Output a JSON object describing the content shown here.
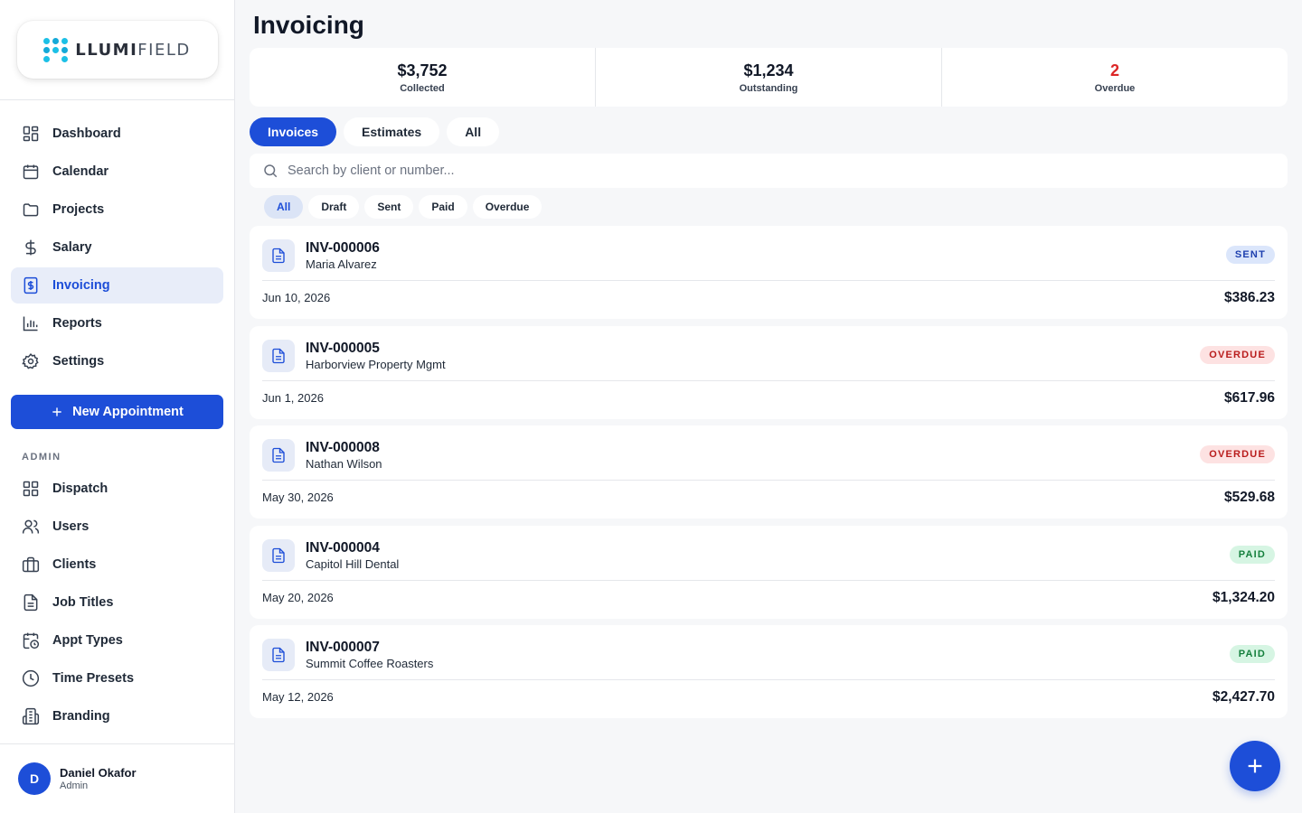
{
  "brand": {
    "logo_text_bold": "LLUMI",
    "logo_text_light": "FIELD",
    "logo_icon": "dots-pin-icon"
  },
  "sidebar": {
    "items": [
      {
        "label": "Dashboard",
        "icon": "grid-icon",
        "active": false
      },
      {
        "label": "Calendar",
        "icon": "calendar-icon",
        "active": false
      },
      {
        "label": "Projects",
        "icon": "folder-icon",
        "active": false
      },
      {
        "label": "Salary",
        "icon": "dollar-icon",
        "active": false
      },
      {
        "label": "Invoicing",
        "icon": "invoice-icon",
        "active": true
      },
      {
        "label": "Reports",
        "icon": "bar-chart-icon",
        "active": false
      },
      {
        "label": "Settings",
        "icon": "gear-icon",
        "active": false
      }
    ],
    "new_appointment_label": "New Appointment",
    "admin_label": "ADMIN",
    "admin_items": [
      {
        "label": "Dispatch",
        "icon": "grid-icon"
      },
      {
        "label": "Users",
        "icon": "users-icon"
      },
      {
        "label": "Clients",
        "icon": "briefcase-icon"
      },
      {
        "label": "Job Titles",
        "icon": "document-icon"
      },
      {
        "label": "Appt Types",
        "icon": "calendar-clock-icon"
      },
      {
        "label": "Time Presets",
        "icon": "clock-icon"
      },
      {
        "label": "Branding",
        "icon": "building-icon"
      }
    ],
    "user": {
      "initial": "D",
      "name": "Daniel Okafor",
      "role": "Admin"
    }
  },
  "main": {
    "title": "Invoicing",
    "stats": [
      {
        "value": "$3,752",
        "label": "Collected",
        "color": "#111827"
      },
      {
        "value": "$1,234",
        "label": "Outstanding",
        "color": "#111827"
      },
      {
        "value": "2",
        "label": "Overdue",
        "color": "#dc2626"
      }
    ],
    "tabs": [
      {
        "label": "Invoices",
        "active": true
      },
      {
        "label": "Estimates",
        "active": false
      },
      {
        "label": "All",
        "active": false
      }
    ],
    "search": {
      "placeholder": "Search by client or number...",
      "value": ""
    },
    "filters": [
      {
        "label": "All",
        "active": true
      },
      {
        "label": "Draft",
        "active": false
      },
      {
        "label": "Sent",
        "active": false
      },
      {
        "label": "Paid",
        "active": false
      },
      {
        "label": "Overdue",
        "active": false
      }
    ],
    "invoices": [
      {
        "number": "INV-000006",
        "client": "Maria Alvarez",
        "date": "Jun 10, 2026",
        "amount": "$386.23",
        "status": "SENT",
        "status_class": "sent"
      },
      {
        "number": "INV-000005",
        "client": "Harborview Property Mgmt",
        "date": "Jun 1, 2026",
        "amount": "$617.96",
        "status": "OVERDUE",
        "status_class": "overdue"
      },
      {
        "number": "INV-000008",
        "client": "Nathan Wilson",
        "date": "May 30, 2026",
        "amount": "$529.68",
        "status": "OVERDUE",
        "status_class": "overdue"
      },
      {
        "number": "INV-000004",
        "client": "Capitol Hill Dental",
        "date": "May 20, 2026",
        "amount": "$1,324.20",
        "status": "PAID",
        "status_class": "paid"
      },
      {
        "number": "INV-000007",
        "client": "Summit Coffee Roasters",
        "date": "May 12, 2026",
        "amount": "$2,427.70",
        "status": "PAID",
        "status_class": "paid"
      }
    ]
  },
  "colors": {
    "accent": "#1d4ed8",
    "danger": "#dc2626",
    "success": "#15803d"
  }
}
